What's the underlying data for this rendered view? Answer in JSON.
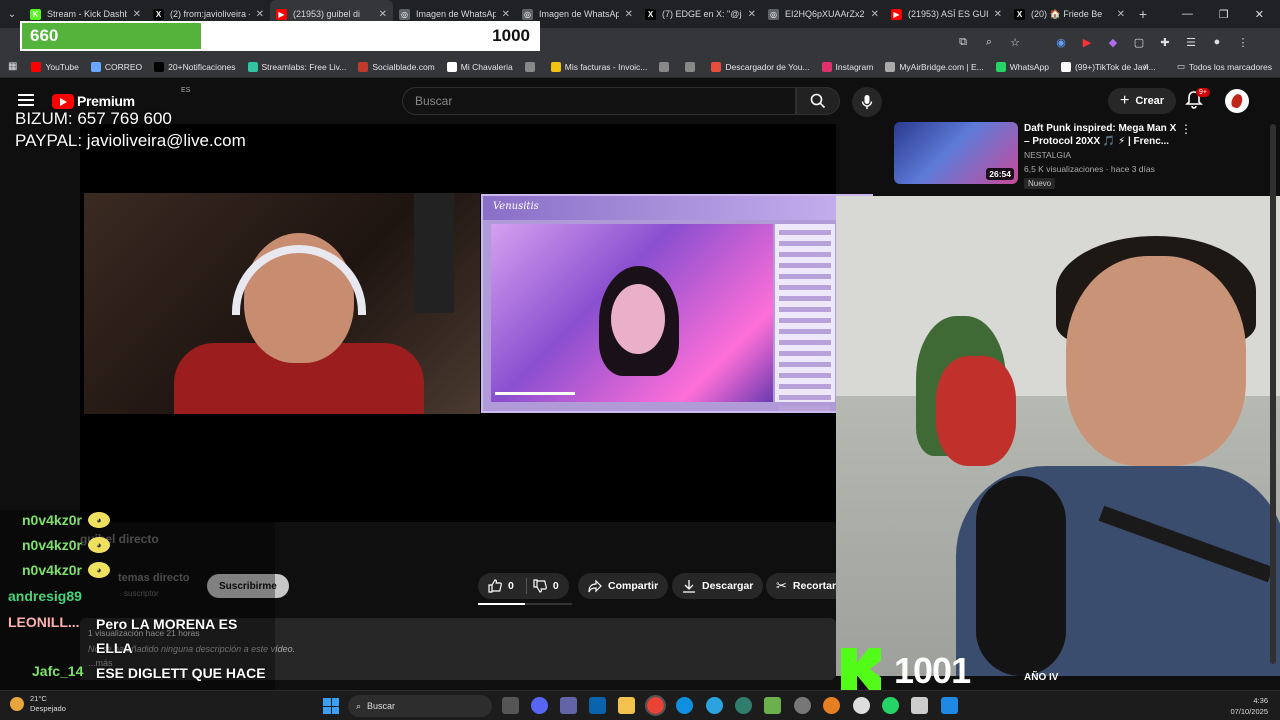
{
  "browser": {
    "tabs": [
      {
        "title": "Stream - Kick Dashbo",
        "fav_color": "#53fc18",
        "fav_glyph": "K"
      },
      {
        "title": "(2) from:javioliveira -",
        "fav_color": "#000000",
        "fav_glyph": "X"
      },
      {
        "title": "(21953) guibel di",
        "fav_color": "#ff0000",
        "fav_glyph": "▶",
        "active": true
      },
      {
        "title": "Imagen de WhatsApp",
        "fav_color": "#5f6368",
        "fav_glyph": "◎"
      },
      {
        "title": "Imagen de WhatsApp",
        "fav_color": "#5f6368",
        "fav_glyph": "◎"
      },
      {
        "title": "(7) EDGE en X: \"@jav",
        "fav_color": "#000000",
        "fav_glyph": "X"
      },
      {
        "title": "EI2HQ6pXUAArZx2.jp",
        "fav_color": "#5f6368",
        "fav_glyph": "◎"
      },
      {
        "title": "(21953) ASÍ ES GUIB",
        "fav_color": "#ff0000",
        "fav_glyph": "▶"
      },
      {
        "title": "(20) 🏠 Friede Be",
        "fav_color": "#000000",
        "fav_glyph": "X"
      }
    ],
    "bookmarks": [
      {
        "label": "YouTube",
        "color": "#ff0000"
      },
      {
        "label": "CORREO",
        "color": "#6aa7ff"
      },
      {
        "label": "20+Notificaciones",
        "color": "#000000"
      },
      {
        "label": "Streamlabs: Free Liv...",
        "color": "#31c3a2"
      },
      {
        "label": "Socialblade.com",
        "color": "#c0392b"
      },
      {
        "label": "Mi Chavaleria",
        "color": "#ffffff"
      },
      {
        "label": "",
        "color": "#888888"
      },
      {
        "label": "Mis facturas - Invoic...",
        "color": "#f1c40f"
      },
      {
        "label": "",
        "color": "#888888"
      },
      {
        "label": "",
        "color": "#888888"
      },
      {
        "label": "Descargador de You...",
        "color": "#e74c3c"
      },
      {
        "label": "Instagram",
        "color": "#e1306c"
      },
      {
        "label": "MyAirBridge.com | E...",
        "color": "#aaaaaa"
      },
      {
        "label": "WhatsApp",
        "color": "#25d366"
      },
      {
        "label": "(99+)TikTok de Javi...",
        "color": "#ffffff"
      }
    ],
    "all_bookmarks": "Todos los marcadores"
  },
  "sub_goal": {
    "current": "660",
    "label": "SUBSCRIBERS",
    "target": "1000",
    "progress": 0.66
  },
  "youtube": {
    "brand": "Premium",
    "region": "ES",
    "search_placeholder": "Buscar",
    "create_label": "Crear",
    "notif_count": "9+"
  },
  "donation": {
    "line1": "BIZUM: 657 769 600",
    "line2": "PAYPAL: javioliveira@live.com"
  },
  "video_panel": {
    "stream_title": "Venusitis",
    "channel_ghost": "guibel directo",
    "channel_ghost2": "temas directo",
    "subs_ghost": "suscriptor",
    "subscribe_label": "Suscribirme",
    "like_count": "0",
    "dislike_count": "0",
    "share_label": "Compartir",
    "download_label": "Descargar",
    "clip_label": "Recortar",
    "desc_meta": "1 visualización  hace 21 horas",
    "desc_text": "No se ha añadido ninguna descripción a este vídeo.",
    "desc_more": "...más"
  },
  "chat": [
    {
      "user": "n0v4kz0r",
      "color": "#7ee06a",
      "message": ""
    },
    {
      "user": "n0v4kz0r",
      "color": "#7ee06a",
      "message": ""
    },
    {
      "user": "n0v4kz0r",
      "color": "#7ee06a",
      "message": ""
    },
    {
      "user": "andresig89",
      "color": "#47d47a",
      "message": ""
    },
    {
      "user": "LEONILL...",
      "color": "#ffb0b0",
      "message": "Pero LA MORENA ES ELLA"
    },
    {
      "user": "Jafc_14",
      "color": "#7ee06a",
      "message": "ESE DIGLETT QUE HACE CON SU JYNX"
    }
  ],
  "recommendation": {
    "title": "Daft Punk inspired: Mega Man X – Protocol 20XX 🎵 ⚡ | Frenc...",
    "channel": "NESTALGIA",
    "stats": "6,5 K visualizaciones · hace 3 días",
    "badge": "Nuevo",
    "duration": "26:54"
  },
  "kick": {
    "count": "1001",
    "label": "AÑO IV"
  },
  "taskbar": {
    "weather_temp": "21°C",
    "weather_text": "Despejado",
    "search_label": "Buscar",
    "time": "4:36",
    "date": "07/10/2025"
  }
}
